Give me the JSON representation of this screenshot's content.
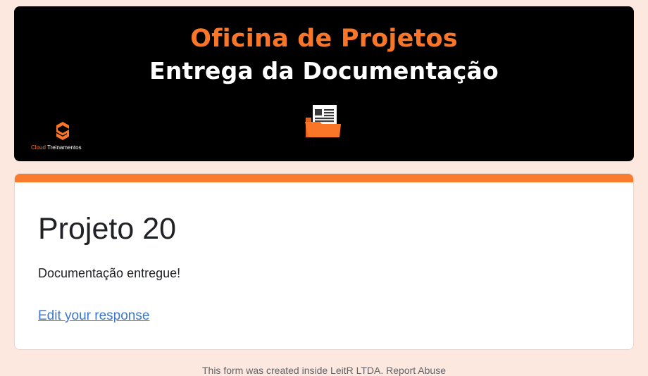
{
  "banner": {
    "title_line1": "Oficina de Projetos",
    "title_line2": "Entrega da Documentação",
    "logo_text_part1": "Cloud",
    "logo_text_part2": " Treinamentos",
    "doc_icon": "folder-document-icon",
    "logo_icon": "cloud-treinamentos-logo-icon"
  },
  "card": {
    "title": "Projeto 20",
    "message": "Documentação entregue!",
    "edit_link": "Edit your response"
  },
  "footer": {
    "text": "This form was created inside LeitR LTDA. Report Abuse"
  },
  "colors": {
    "page_bg": "#fde8df",
    "accent": "#fa7a2e",
    "banner_bg": "#000000",
    "link": "#3d77c7"
  }
}
